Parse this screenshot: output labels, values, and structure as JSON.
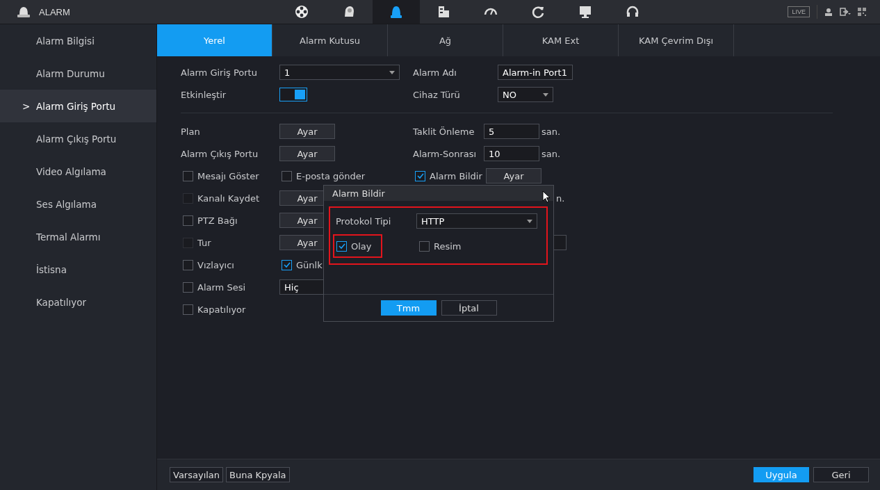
{
  "top_bar": {
    "title": "ALARM",
    "icons": [
      {
        "kind": "film",
        "selected": false
      },
      {
        "kind": "head",
        "selected": false
      },
      {
        "kind": "alarm",
        "selected": true
      },
      {
        "kind": "storage",
        "selected": false
      },
      {
        "kind": "gauge",
        "selected": false
      },
      {
        "kind": "refresh",
        "selected": false
      },
      {
        "kind": "monitor",
        "selected": false
      },
      {
        "kind": "headset",
        "selected": false
      }
    ],
    "live": "LIVE"
  },
  "sidebar": {
    "items": [
      {
        "label": "Alarm Bilgisi",
        "selected": false
      },
      {
        "label": "Alarm Durumu",
        "selected": false
      },
      {
        "label": "Alarm Giriş Portu",
        "selected": true,
        "marker": ">"
      },
      {
        "label": "Alarm Çıkış Portu",
        "selected": false
      },
      {
        "label": "Video Algılama",
        "selected": false
      },
      {
        "label": "Ses Algılama",
        "selected": false
      },
      {
        "label": "Termal Alarmı",
        "selected": false
      },
      {
        "label": "İstisna",
        "selected": false
      },
      {
        "label": "Kapatılıyor",
        "selected": false
      }
    ]
  },
  "tabs": [
    {
      "label": "Yerel",
      "selected": true
    },
    {
      "label": "Alarm Kutusu",
      "selected": false
    },
    {
      "label": "Ağ",
      "selected": false
    },
    {
      "label": "KAM Ext",
      "selected": false
    },
    {
      "label": "KAM Çevrim Dışı",
      "selected": false
    }
  ],
  "form": {
    "sections": [
      {
        "rows": [
          {
            "left": [
              {
                "kind": "label",
                "text": "Alarm Giriş Portu"
              }
            ],
            "middle": [
              {
                "kind": "select",
                "value": "1"
              }
            ],
            "right": [
              {
                "kind": "label",
                "text": "Alarm Adı"
              },
              {
                "kind": "field",
                "value": "Alarm-in Port1"
              }
            ]
          },
          {
            "left": [
              {
                "kind": "label",
                "text": "Etkinleştir"
              }
            ],
            "middle": [
              {
                "kind": "toggle",
                "on": true
              }
            ],
            "right": [
              {
                "kind": "label",
                "text": "Cihaz Türü"
              },
              {
                "kind": "select",
                "value": "NO"
              }
            ]
          }
        ]
      },
      {
        "rows": [
          {
            "left": [
              {
                "kind": "label",
                "text": "Plan"
              }
            ],
            "middle": [
              {
                "kind": "button",
                "label": "Ayar"
              }
            ],
            "right": [
              {
                "kind": "label",
                "text": "Taklit Önleme"
              },
              {
                "kind": "field",
                "value": "5"
              },
              {
                "kind": "unit",
                "text": "san."
              }
            ]
          },
          {
            "left": [
              {
                "kind": "label",
                "text": "Alarm Çıkış Portu"
              }
            ],
            "middle": [
              {
                "kind": "button",
                "label": "Ayar"
              }
            ],
            "right": [
              {
                "kind": "label",
                "text": "Alarm-Sonrası"
              },
              {
                "kind": "field",
                "value": "10"
              },
              {
                "kind": "unit",
                "text": "san."
              }
            ]
          },
          {
            "left": [
              {
                "kind": "checkbox",
                "label": "Mesajı Göster",
                "checked": false,
                "disabled": false
              }
            ],
            "middle": [
              {
                "kind": "checkbox",
                "label": "E-posta gönder",
                "checked": false,
                "disabled": false
              }
            ],
            "right": [
              {
                "kind": "checkbox",
                "label": "Alarm Bildir",
                "checked": true,
                "disabled": false
              },
              {
                "kind": "button",
                "label": "Ayar"
              }
            ]
          },
          {
            "left": [
              {
                "kind": "checkbox",
                "label": "Kanalı Kaydet",
                "checked": false,
                "disabled": true
              }
            ],
            "middle": [
              {
                "kind": "button",
                "label": "Ayar"
              }
            ],
            "right": [
              {
                "kind": "unit",
                "text": "n."
              }
            ]
          },
          {
            "left": [
              {
                "kind": "checkbox",
                "label": "PTZ Bağı",
                "checked": false,
                "disabled": false
              }
            ],
            "middle": [
              {
                "kind": "button",
                "label": "Ayar"
              }
            ],
            "right": []
          },
          {
            "left": [
              {
                "kind": "checkbox",
                "label": "Tur",
                "checked": false,
                "disabled": true
              }
            ],
            "middle": [
              {
                "kind": "button",
                "label": "Ayar"
              }
            ],
            "right": [
              {
                "kind": "field"
              }
            ]
          },
          {
            "left": [
              {
                "kind": "checkbox",
                "label": "Vızlayıcı",
                "checked": false,
                "disabled": false
              }
            ],
            "middle": [
              {
                "kind": "checkbox",
                "label": "Günlk",
                "checked": true,
                "disabled": false
              }
            ],
            "right": []
          },
          {
            "left": [
              {
                "kind": "checkbox",
                "label": "Alarm Sesi",
                "checked": false,
                "disabled": false
              }
            ],
            "middle": [
              {
                "kind": "select",
                "value": "Hiç"
              }
            ],
            "right": []
          },
          {
            "left": [
              {
                "kind": "checkbox",
                "label": "Kapatılıyor",
                "checked": false,
                "disabled": false
              }
            ],
            "middle": [],
            "right": []
          }
        ]
      }
    ]
  },
  "dialog": {
    "title": "Alarm Bildir",
    "protocol_label": "Protokol Tipi",
    "protocol_value": "HTTP",
    "options": [
      {
        "label": "Olay",
        "checked": true,
        "highlighted": true
      },
      {
        "label": "Resim",
        "checked": false,
        "highlighted": false
      }
    ],
    "buttons": [
      {
        "label": "Tmm",
        "primary": true
      },
      {
        "label": "İptal",
        "primary": false
      }
    ]
  },
  "footer": {
    "left_buttons": [
      {
        "label": "Varsayılan",
        "primary": false
      },
      {
        "label": "Buna Kpyala",
        "primary": false
      }
    ],
    "right_buttons": [
      {
        "label": "Uygula",
        "primary": true
      },
      {
        "label": "Geri",
        "primary": false
      }
    ]
  }
}
